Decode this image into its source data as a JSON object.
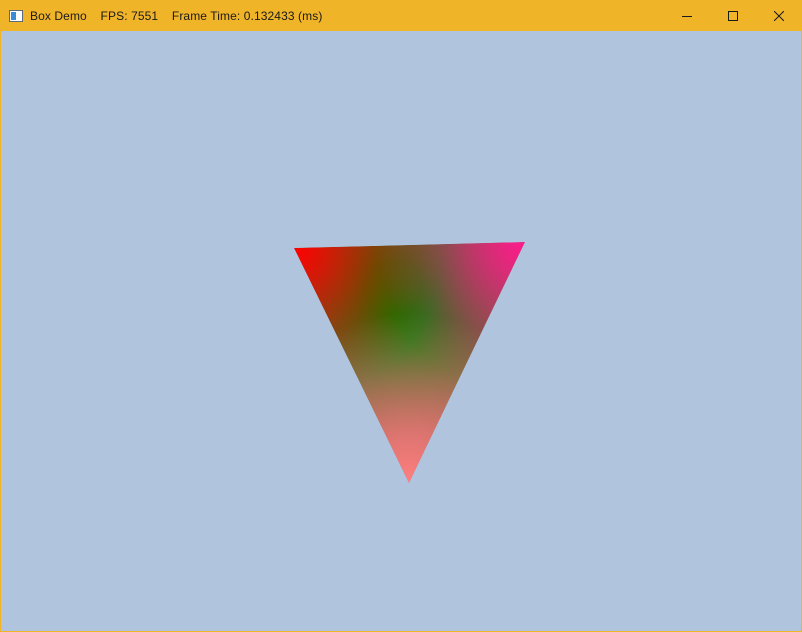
{
  "window": {
    "title": "Box Demo    FPS: 7551    Frame Time: 0.132433 (ms)",
    "titlebar_color": "#f0b429",
    "clear_color": "#b0c4de"
  },
  "controls": {
    "minimize_icon": "minimize-icon",
    "maximize_icon": "maximize-icon",
    "close_icon": "close-icon"
  },
  "scene": {
    "object": "triangle",
    "vertex_colors": {
      "top_left": "#ff0000",
      "top_right": "#ff1a8c",
      "bottom": "#ff7f7f",
      "center": "#008000"
    }
  }
}
